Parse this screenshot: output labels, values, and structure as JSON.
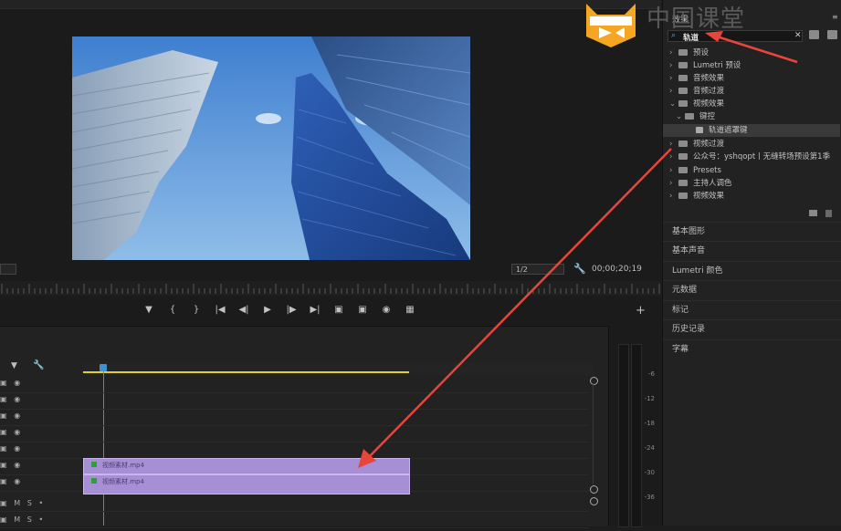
{
  "watermark": {
    "text": "中国课堂"
  },
  "monitor": {
    "zoom_dropdown": "",
    "resolution": "1/2",
    "timecode": "00;00;20;19",
    "transport": [
      "mark-in",
      "{",
      "}",
      "go-to-in",
      "step-back",
      "play",
      "step-forward",
      "go-to-out",
      "lift",
      "extract",
      "export-frame",
      "compare"
    ]
  },
  "timeline": {
    "tracks": [
      {
        "type": "video"
      },
      {
        "type": "video"
      },
      {
        "type": "video"
      },
      {
        "type": "video"
      },
      {
        "type": "video"
      },
      {
        "type": "video",
        "clip": "视频素材.mp4"
      },
      {
        "type": "video",
        "clip": "视频素材.mp4"
      },
      {
        "type": "audio",
        "m": "M",
        "s": "S"
      },
      {
        "type": "audio",
        "m": "M",
        "s": "S"
      }
    ],
    "meter_labels": [
      "-6",
      "-12",
      "-18",
      "-24",
      "-30",
      "-36"
    ]
  },
  "effects_panel": {
    "title": "效果",
    "search_value": "轨道",
    "tree": [
      {
        "label": "预设",
        "level": 0,
        "expanded": false
      },
      {
        "label": "Lumetri 预设",
        "level": 0,
        "expanded": false
      },
      {
        "label": "音频效果",
        "level": 0,
        "expanded": false
      },
      {
        "label": "音频过渡",
        "level": 0,
        "expanded": false
      },
      {
        "label": "视频效果",
        "level": 0,
        "expanded": true
      },
      {
        "label": "键控",
        "level": 1,
        "expanded": true
      },
      {
        "label": "轨道遮罩键",
        "level": 2,
        "selected": true
      },
      {
        "label": "视频过渡",
        "level": 0,
        "expanded": false
      },
      {
        "label": "公众号：yshqopt丨无缝转场预设第1季",
        "level": 0,
        "expanded": false
      },
      {
        "label": "Presets",
        "level": 0,
        "expanded": false
      },
      {
        "label": "主持人调色",
        "level": 0,
        "expanded": false
      },
      {
        "label": "视频效果",
        "level": 0,
        "expanded": false
      }
    ],
    "panels": [
      "基本图形",
      "基本声音",
      "Lumetri 颜色",
      "元数据",
      "标记",
      "历史记录",
      "字幕"
    ]
  },
  "colors": {
    "clip": "#a78fd6",
    "annotation_arrow": "#e8453c",
    "playhead": "#3d8fd6",
    "work_area": "#e0d12b"
  }
}
